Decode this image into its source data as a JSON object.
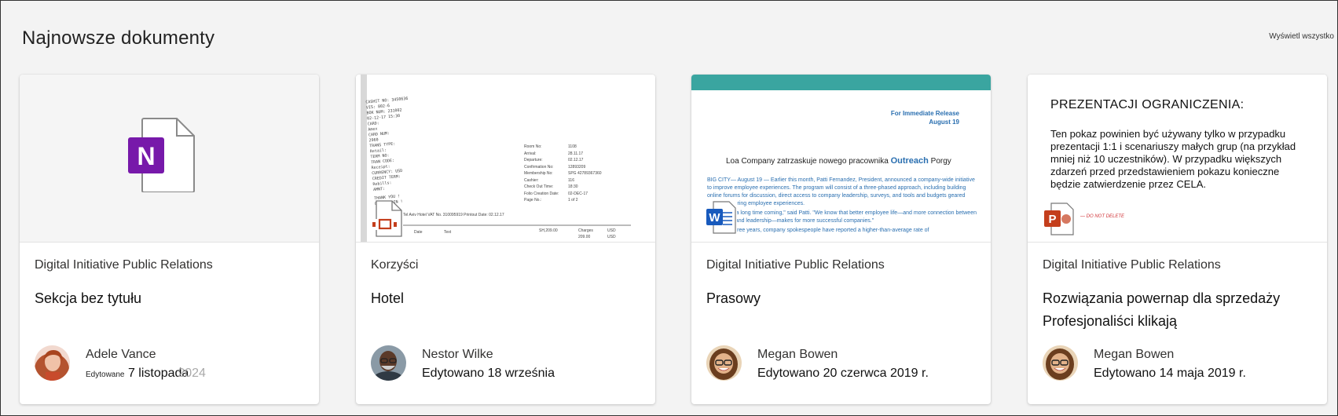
{
  "section": {
    "title": "Najnowsze dokumenty",
    "view_all": "Wyświetl wszystko"
  },
  "cards": [
    {
      "site": "Digital Initiative Public Relations",
      "title": "Sekcja bez tytułu",
      "author": "Adele Vance",
      "edited_prefix": "Edytowane",
      "edited_date": "7 listopada",
      "edited_year": "2024",
      "app_icon": "onenote-icon"
    },
    {
      "site": "Korzyści",
      "title": "Hotel",
      "author": "Nestor Wilke",
      "edited": "Edytowano 18 września",
      "thumb": {
        "fields": [
          "Room No:",
          "Arrival:",
          "Departure:",
          "Confirmation No:",
          "Membership No:",
          "Cashier:",
          "Check Out Time:",
          "Folio Creation Date:",
          "Page No.:"
        ],
        "values": [
          "1108",
          "28.11.17",
          "02.12.17",
          "12893209",
          "SPG 42789367360",
          "116",
          "18:30",
          "02-DEC-17",
          "1 of 2"
        ],
        "hotel_line": "Tel Aviv Hotel      VAT No. 310095919      Printout Date:      02.12.17",
        "amount": "SH,209.00",
        "charges": "Charges",
        "charges_value": "209.00",
        "cur1": "USD",
        "cur2": "USD",
        "col_date": "Date",
        "col_text": "Text",
        "receipt_text": [
          "CASHIT NO: 3450636",
          "VIS: 802-6",
          "BOK NUM: 231002",
          "02-12-17   15:30",
          "CARD:",
          "Amex",
          "CARD NUM:",
          "2960",
          "TRANS TYPE:",
          "Retail:",
          "TERM NO:",
          "TRAN CODE:",
          "Receipt:",
          "CURRENCY: USD",
          "CREDIT TERM:",
          "Rebills:",
          "AMNT:",
          "THANK YOU !",
          "COME AGAIN !"
        ]
      }
    },
    {
      "site": "Digital Initiative Public Relations",
      "title": "Prasowy",
      "author": "Megan Bowen",
      "edited": "Edytowano 20 czerwca 2019 r.",
      "app_icon": "word-icon",
      "thumb": {
        "release": "For Immediate Release",
        "release_date": "August 19",
        "headline": "Loa Company zatrzaskuje nowego pracownika",
        "headline_bold": "Outreach",
        "headline_tail": "Porgy",
        "para1": "BIG CITY— August 19 — Earlier this month, Patti Fernandez, President, announced a company-wide initiative to improve employee experiences. The program will consist of a three-phased approach, including building online forums for discussion, direct access to company leadership, surveys, and tools and budgets geared toward bettering employee experiences.",
        "para2": "It has been a long time coming,\" said Patti. \"We know that better employee life—and more connection between employees and leadership—makes for more successful companies.\"",
        "para3": "In the last three years, company spokespeople have reported a higher-than-average rate of"
      }
    },
    {
      "site": "Digital Initiative Public Relations",
      "title": "Rozwiązania powernap dla sprzedaży Profesjonaliści klikają",
      "author": "Megan Bowen",
      "edited": "Edytowano 14 maja 2019 r.",
      "app_icon": "powerpoint-icon",
      "thumb": {
        "heading": "PREZENTACJI   OGRANICZENIA:",
        "body": "Ten pokaz powinien być używany tylko w przypadku prezentacji 1:1 i scenariuszy małych grup (na przykład mniej niż 10 uczestników). W przypadku większych zdarzeń przed przedstawieniem pokazu konieczne będzie zatwierdzenie przez CELA.",
        "note": "— DO NOT DELETE"
      }
    }
  ],
  "colors": {
    "onenote": "#7719aa",
    "word": "#185abd",
    "powerpoint": "#c43e1c",
    "press_accent": "#3aa5a0"
  }
}
